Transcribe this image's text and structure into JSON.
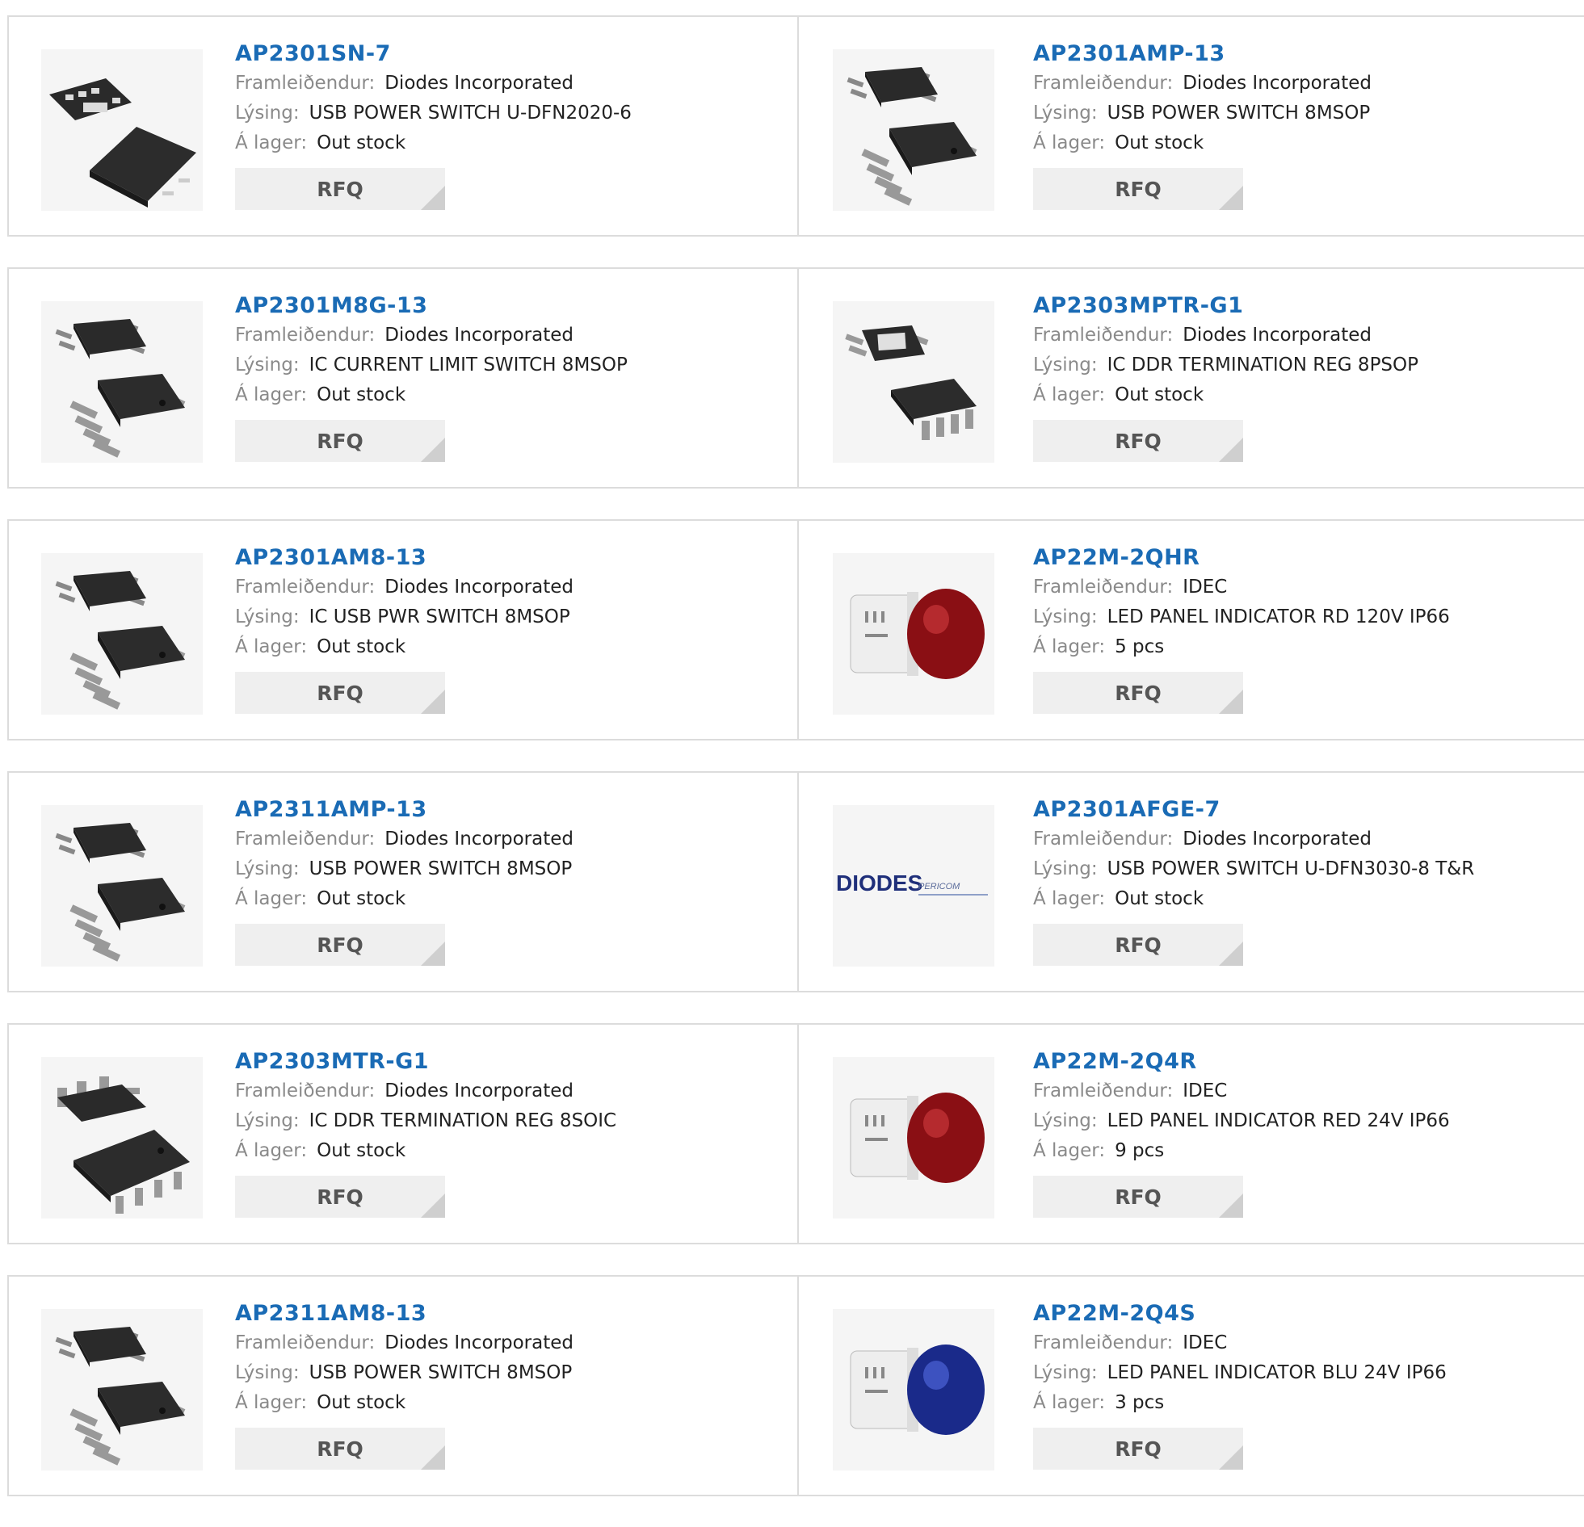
{
  "labels": {
    "manufacturer": "Framleiðendur:",
    "description": "Lýsing:",
    "stock": "Á lager:",
    "rfq": "RFQ"
  },
  "colors": {
    "link": "#1a6bb5",
    "label": "#8a8a8a",
    "button_bg": "#efefef"
  },
  "rows": [
    {
      "left": {
        "part": "AP2301SN-7",
        "manufacturer": "Diodes Incorporated",
        "description": "USB POWER SWITCH U-DFN2020-6",
        "stock": "Out stock",
        "image": "dfn-chip-icon"
      },
      "right": {
        "part": "AP2301AMP-13",
        "manufacturer": "Diodes Incorporated",
        "description": "USB POWER SWITCH 8MSOP",
        "stock": "Out stock",
        "image": "msop-chip-icon"
      }
    },
    {
      "left": {
        "part": "AP2301M8G-13",
        "manufacturer": "Diodes Incorporated",
        "description": "IC CURRENT LIMIT SWITCH 8MSOP",
        "stock": "Out stock",
        "image": "msop-chip-icon"
      },
      "right": {
        "part": "AP2303MPTR-G1",
        "manufacturer": "Diodes Incorporated",
        "description": "IC DDR TERMINATION REG 8PSOP",
        "stock": "Out stock",
        "image": "psop-chip-icon"
      }
    },
    {
      "left": {
        "part": "AP2301AM8-13",
        "manufacturer": "Diodes Incorporated",
        "description": "IC USB PWR SWITCH 8MSOP",
        "stock": "Out stock",
        "image": "msop-chip-icon"
      },
      "right": {
        "part": "AP22M-2QHR",
        "manufacturer": "IDEC",
        "description": "LED PANEL INDICATOR RD 120V IP66",
        "stock": "5 pcs",
        "image": "red-indicator-icon"
      }
    },
    {
      "left": {
        "part": "AP2311AMP-13",
        "manufacturer": "Diodes Incorporated",
        "description": "USB POWER SWITCH 8MSOP",
        "stock": "Out stock",
        "image": "msop-chip-icon"
      },
      "right": {
        "part": "AP2301AFGE-7",
        "manufacturer": "Diodes Incorporated",
        "description": "USB POWER SWITCH U-DFN3030-8 T&R",
        "stock": "Out stock",
        "image": "diodes-logo"
      }
    },
    {
      "left": {
        "part": "AP2303MTR-G1",
        "manufacturer": "Diodes Incorporated",
        "description": "IC DDR TERMINATION REG 8SOIC",
        "stock": "Out stock",
        "image": "soic-chip-icon"
      },
      "right": {
        "part": "AP22M-2Q4R",
        "manufacturer": "IDEC",
        "description": "LED PANEL INDICATOR RED 24V IP66",
        "stock": "9 pcs",
        "image": "red-indicator-icon"
      }
    },
    {
      "left": {
        "part": "AP2311AM8-13",
        "manufacturer": "Diodes Incorporated",
        "description": "USB POWER SWITCH 8MSOP",
        "stock": "Out stock",
        "image": "msop-chip-icon"
      },
      "right": {
        "part": "AP22M-2Q4S",
        "manufacturer": "IDEC",
        "description": "LED PANEL INDICATOR BLU 24V IP66",
        "stock": "3 pcs",
        "image": "blue-indicator-icon"
      }
    }
  ],
  "logo_text": {
    "diodes": "DIODES",
    "pericom": "PERICOM"
  }
}
